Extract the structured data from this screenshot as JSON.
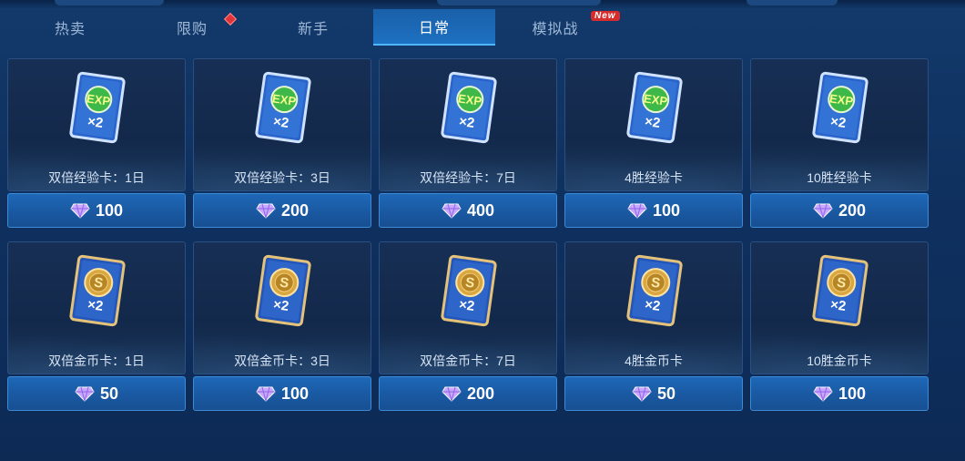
{
  "tabs": [
    {
      "label": "热卖",
      "active": false,
      "badge": ""
    },
    {
      "label": "限购",
      "active": false,
      "badge": "red-dot"
    },
    {
      "label": "新手",
      "active": false,
      "badge": ""
    },
    {
      "label": "日常",
      "active": true,
      "badge": ""
    },
    {
      "label": "模拟战",
      "active": false,
      "badge": "New"
    }
  ],
  "items": [
    {
      "name": "双倍经验卡：1日",
      "price": "100",
      "icon": "exp-card-icon"
    },
    {
      "name": "双倍经验卡：3日",
      "price": "200",
      "icon": "exp-card-icon"
    },
    {
      "name": "双倍经验卡：7日",
      "price": "400",
      "icon": "exp-card-icon"
    },
    {
      "name": "4胜经验卡",
      "price": "100",
      "icon": "exp-card-icon"
    },
    {
      "name": "10胜经验卡",
      "price": "200",
      "icon": "exp-card-icon"
    },
    {
      "name": "双倍金币卡：1日",
      "price": "50",
      "icon": "gold-card-icon"
    },
    {
      "name": "双倍金币卡：3日",
      "price": "100",
      "icon": "gold-card-icon"
    },
    {
      "name": "双倍金币卡：7日",
      "price": "200",
      "icon": "gold-card-icon"
    },
    {
      "name": "4胜金币卡",
      "price": "50",
      "icon": "gold-card-icon"
    },
    {
      "name": "10胜金币卡",
      "price": "100",
      "icon": "gold-card-icon"
    }
  ],
  "card_labels": {
    "exp": "EXP",
    "multiplier": "×2",
    "gold": "S"
  },
  "currency_icon": "diamond-gem-icon",
  "colors": {
    "active_tab": "#1d71c2",
    "price_bar": "#1a5aa3",
    "badge_red": "#d62c2c"
  }
}
